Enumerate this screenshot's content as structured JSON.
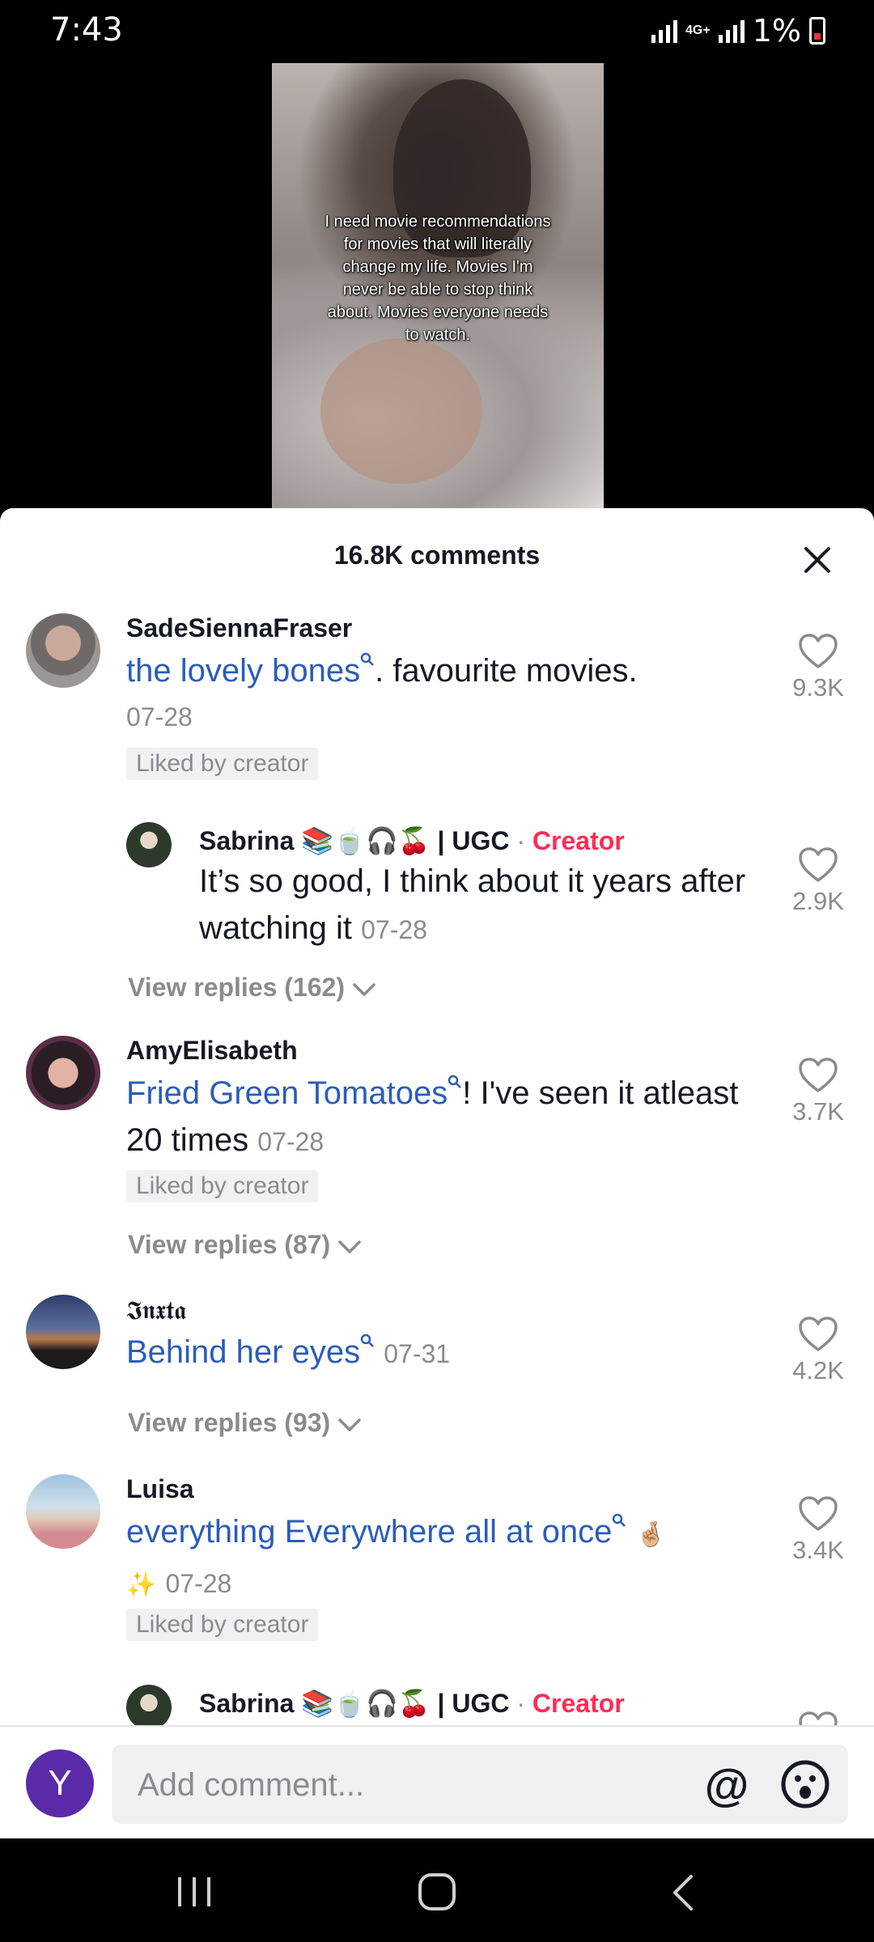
{
  "status": {
    "time": "7:43",
    "network": "4G+",
    "battery": "1%"
  },
  "video": {
    "caption": "I need movie recommendations for movies that will literally change my life. Movies I'm never be able to stop think about. Movies everyone needs to watch."
  },
  "sheet": {
    "title": "16.8K comments"
  },
  "comments": [
    {
      "username": "SadeSiennaFraser",
      "link": "the lovely bones",
      "text": ". favourite movies.",
      "date": "07-28",
      "liked_label": "Liked by creator",
      "likes": "9.3K"
    },
    {
      "username": "Sabrina 📚🍵🎧🍒 | UGC",
      "creator_label": "Creator",
      "separator": "·",
      "text": "It’s so good, I think about it years after watching it",
      "date": "07-28",
      "likes": "2.9K"
    },
    {
      "view_replies": "View replies (162)"
    },
    {
      "username": "AmyElisabeth",
      "link": "Fried Green Tomatoes",
      "text": "! I've seen it atleast 20 times",
      "date": "07-28",
      "liked_label": "Liked by creator",
      "likes": "3.7K",
      "view_replies": "View replies (87)"
    },
    {
      "username": "𝕴𝖓𝖝𝖙𝖆",
      "link": "Behind her eyes",
      "date": "07-31",
      "likes": "4.2K",
      "view_replies": "View replies (93)"
    },
    {
      "username": "Luisa",
      "link": "everything Everywhere all at once",
      "trailing": "🤞🏼",
      "line2": "✨",
      "date": "07-28",
      "liked_label": "Liked by creator",
      "likes": "3.4K"
    },
    {
      "username": "Sabrina 📚🍵🎧🍒 | UGC",
      "creator_label": "Creator",
      "separator": "·"
    }
  ],
  "input": {
    "placeholder": "Add comment...",
    "avatar_letter": "Y",
    "at_symbol": "@"
  },
  "icons": [
    "heart-icon",
    "close-icon",
    "chevron-down-icon",
    "search-icon",
    "emoji-icon",
    "recents-icon",
    "home-icon",
    "back-icon"
  ],
  "colors": {
    "link": "#2b5db9",
    "creator": "#fe2c55",
    "muted": "#8a8b91",
    "avatar": "#5b2aa8"
  }
}
